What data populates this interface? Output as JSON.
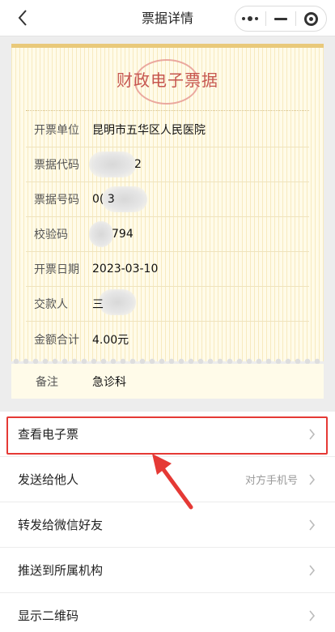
{
  "nav": {
    "title": "票据详情",
    "icons": [
      "back-chevron-icon",
      "more-dots-icon",
      "minimize-icon",
      "close-target-icon"
    ]
  },
  "receipt": {
    "title": "财政电子票据",
    "rows": [
      {
        "label": "开票单位",
        "value": "昆明市五华区人民医院"
      },
      {
        "label": "票据代码",
        "value": "2"
      },
      {
        "label": "票据号码",
        "value": "0( 3"
      },
      {
        "label": "校验码",
        "value": "794"
      },
      {
        "label": "开票日期",
        "value": "2023-03-10"
      },
      {
        "label": "交款人",
        "value": "三"
      },
      {
        "label": "金额合计",
        "value": "4.00元"
      }
    ]
  },
  "remark": {
    "label": "备注",
    "value": "急诊科"
  },
  "actions": [
    {
      "label": "查看电子票",
      "hint": ""
    },
    {
      "label": "发送给他人",
      "hint": "对方手机号"
    },
    {
      "label": "转发给微信好友",
      "hint": ""
    },
    {
      "label": "推送到所属机构",
      "hint": ""
    },
    {
      "label": "显示二维码",
      "hint": ""
    }
  ],
  "annotation": {
    "color": "#e53935"
  }
}
